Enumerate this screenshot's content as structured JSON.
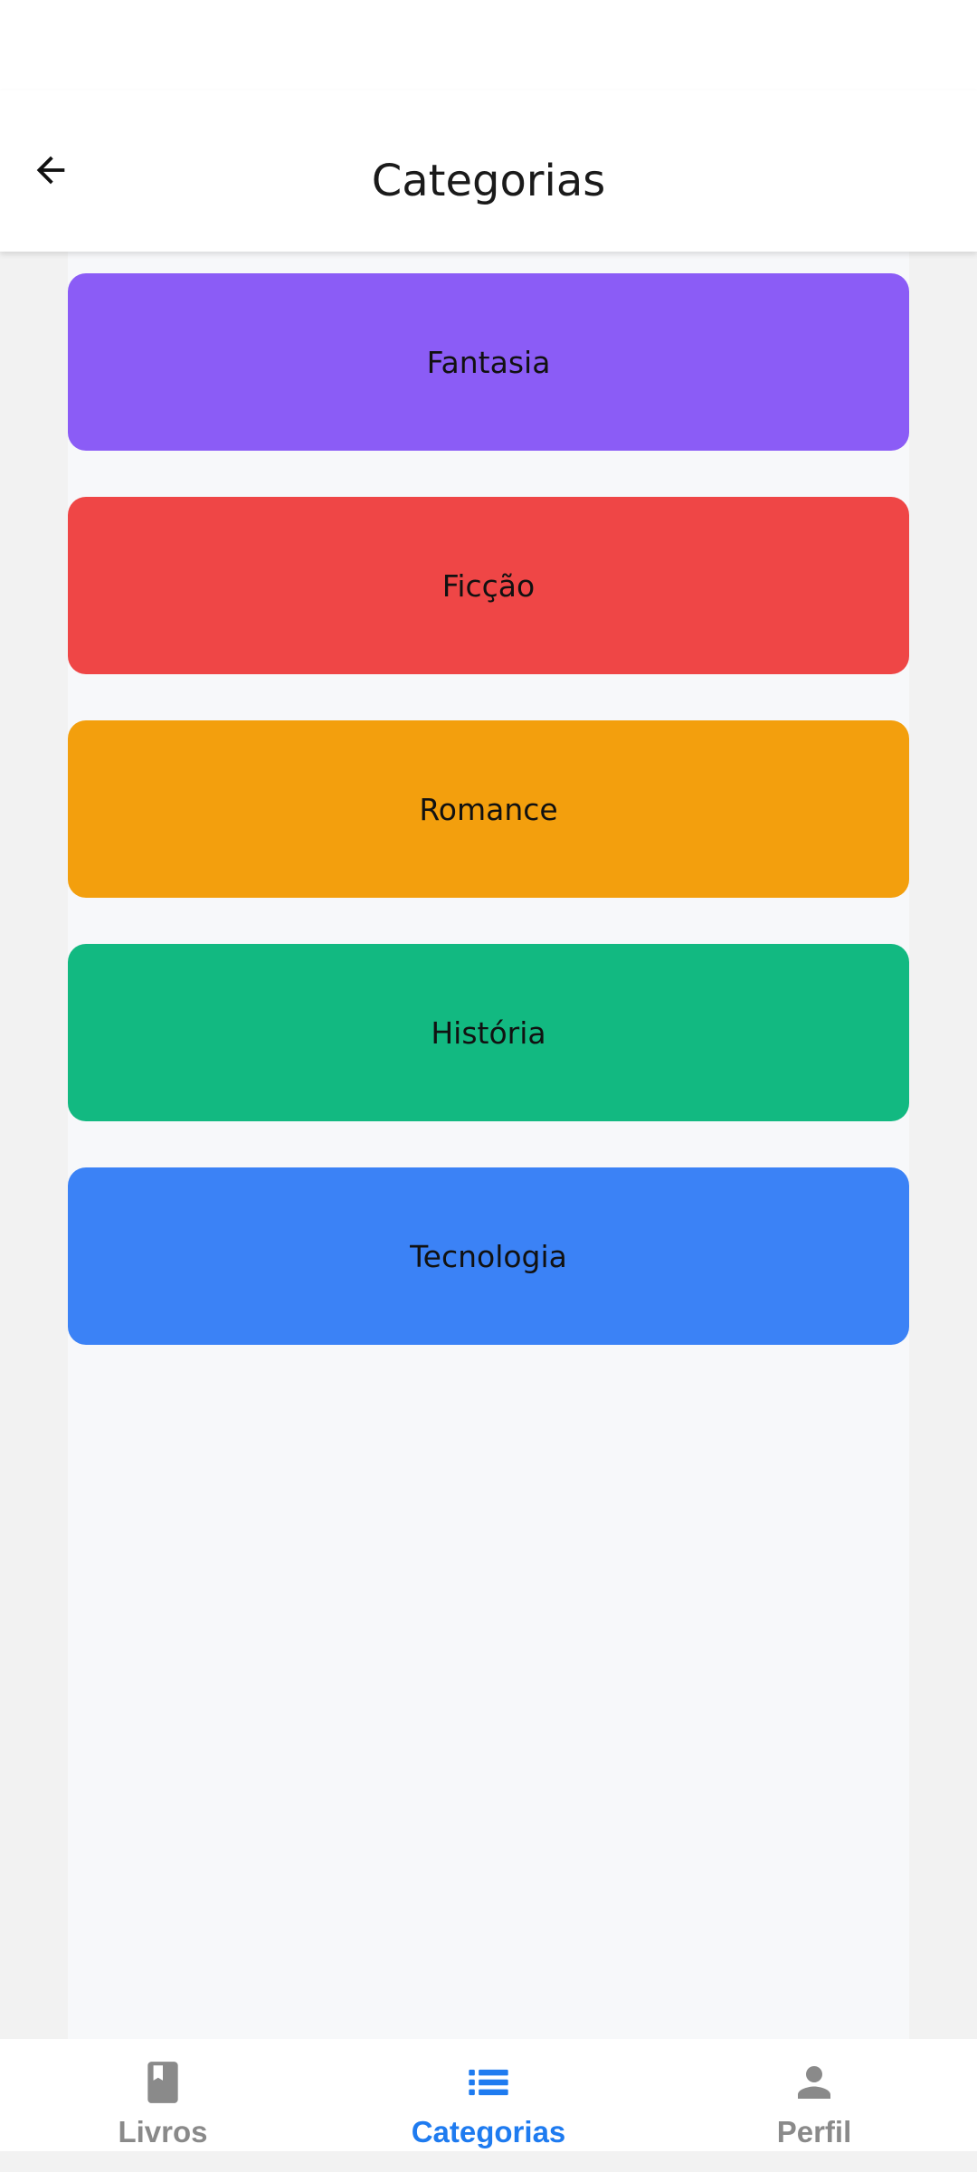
{
  "header": {
    "title": "Categorias",
    "back_icon": "arrow-left-icon"
  },
  "categories": [
    {
      "label": "Fantasia",
      "color": "#8b5cf6"
    },
    {
      "label": "Ficção",
      "color": "#ef4646"
    },
    {
      "label": "Romance",
      "color": "#f39f0d"
    },
    {
      "label": "História",
      "color": "#12b981"
    },
    {
      "label": "Tecnologia",
      "color": "#3b82f6"
    }
  ],
  "bottom_nav": {
    "tabs": [
      {
        "label": "Livros",
        "icon": "book-icon",
        "active": false
      },
      {
        "label": "Categorias",
        "icon": "list-icon",
        "active": true
      },
      {
        "label": "Perfil",
        "icon": "person-icon",
        "active": false
      }
    ],
    "active_color": "#1e7bf0",
    "inactive_color": "#8a8a8a"
  }
}
